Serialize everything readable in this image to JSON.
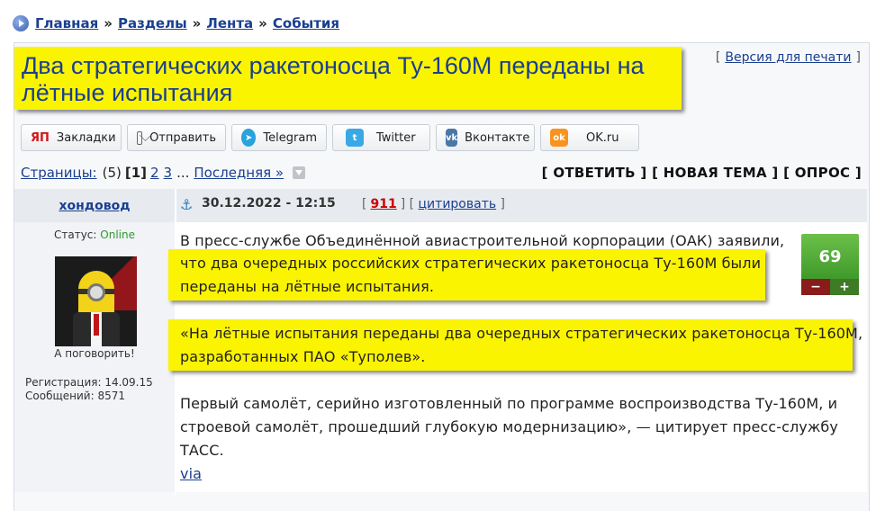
{
  "breadcrumb": {
    "items": [
      "Главная",
      "Разделы",
      "Лента",
      "События"
    ],
    "separator": "»"
  },
  "topic": {
    "title": "Два стратегических ракетоносца Ту-160М переданы на лётные испытания",
    "print_prefix": "[",
    "print_label": "Версия для печати",
    "print_suffix": "]"
  },
  "share": [
    {
      "label": "Закладки",
      "icon": "yap-icon",
      "glyph": "ЯП"
    },
    {
      "label": "Отправить",
      "icon": "mail-icon",
      "glyph": ""
    },
    {
      "label": "Telegram",
      "icon": "telegram-icon",
      "glyph": "➤"
    },
    {
      "label": "Twitter",
      "icon": "twitter-icon",
      "glyph": "t"
    },
    {
      "label": "Вконтакте",
      "icon": "vk-icon",
      "glyph": "vk"
    },
    {
      "label": "OK.ru",
      "icon": "ok-icon",
      "glyph": "ok"
    }
  ],
  "pager": {
    "label": "Страницы:",
    "count": "(5)",
    "current": "[1]",
    "pages": [
      "2",
      "3"
    ],
    "ellipsis": "...",
    "last": "Последняя »"
  },
  "actions": "[ ОТВЕТИТЬ ] [ НОВАЯ ТЕМА ] [ ОПРОС ]",
  "post": {
    "author": "хондовод",
    "anchor_glyph": "⚓",
    "date": "30.12.2022 - 12:15",
    "number": "911",
    "quote_label": "цитировать",
    "status_label": "Статус:",
    "status_value": "Online",
    "avatar_caption": "А поговорить!",
    "registration": "Регистрация: 14.09.15",
    "messages": "Сообщений: 8571",
    "rating": "69",
    "minus": "−",
    "plus": "+",
    "text": {
      "p1_line1": "В пресс-службе Объединённой авиастроительной корпорации (ОАК) заявили,",
      "p1_line2": "что два очередных российских стратегических ракетоносца Ту-160М были",
      "p1_line3": "переданы на лётные испытания.",
      "p2_line1": "«На лётные испытания переданы два очередных стратегических ракетоносца Ту-160М,",
      "p2_line2": "разработанных ПАО «Туполев».",
      "p3_line1": "Первый самолёт, серийно изготовленный по программе воспроизводства Ту-160М, и",
      "p3_line2": "строевой самолёт, прошедший глубокую модернизацию», — цитирует пресс-службу",
      "p3_line3": "ТАСС.",
      "via": "via"
    }
  },
  "colors": {
    "highlight": "#fbf400",
    "link": "#1a3f8f",
    "online": "#2e9a2e",
    "rating": "#4ea832"
  }
}
